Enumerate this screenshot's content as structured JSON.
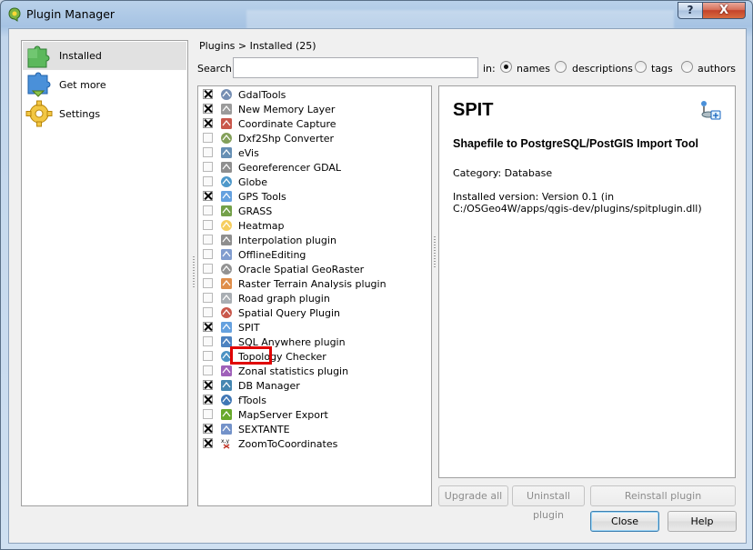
{
  "window": {
    "title": "Plugin Manager",
    "help_glyph": "?",
    "close_glyph": "X"
  },
  "nav": {
    "items": [
      {
        "label": "Installed",
        "icon": "puzzle-green-icon",
        "selected": true
      },
      {
        "label": "Get more",
        "icon": "puzzle-blue-icon",
        "selected": false
      },
      {
        "label": "Settings",
        "icon": "gear-yellow-icon",
        "selected": false
      }
    ]
  },
  "breadcrumb": "Plugins > Installed (25)",
  "search": {
    "label": "Search",
    "value": "",
    "in_label": "in:",
    "options": [
      {
        "label": "names",
        "checked": true
      },
      {
        "label": "descriptions",
        "checked": false
      },
      {
        "label": "tags",
        "checked": false
      },
      {
        "label": "authors",
        "checked": false
      }
    ]
  },
  "plugins": [
    {
      "name": "GdalTools",
      "enabled": true,
      "icon": "gdal-tools-icon"
    },
    {
      "name": "New Memory Layer",
      "enabled": true,
      "icon": "memory-layer-icon"
    },
    {
      "name": "Coordinate Capture",
      "enabled": true,
      "icon": "crosshair-icon"
    },
    {
      "name": "Dxf2Shp Converter",
      "enabled": false,
      "icon": "dxf-convert-icon"
    },
    {
      "name": "eVis",
      "enabled": false,
      "icon": "evis-icon"
    },
    {
      "name": "Georeferencer GDAL",
      "enabled": false,
      "icon": "georeferencer-icon"
    },
    {
      "name": "Globe",
      "enabled": false,
      "icon": "globe-icon"
    },
    {
      "name": "GPS Tools",
      "enabled": true,
      "icon": "gps-icon"
    },
    {
      "name": "GRASS",
      "enabled": false,
      "icon": "grass-icon"
    },
    {
      "name": "Heatmap",
      "enabled": false,
      "icon": "heatmap-icon"
    },
    {
      "name": "Interpolation plugin",
      "enabled": false,
      "icon": "interpolation-icon"
    },
    {
      "name": "OfflineEditing",
      "enabled": false,
      "icon": "offline-editing-icon"
    },
    {
      "name": "Oracle Spatial GeoRaster",
      "enabled": false,
      "icon": "oracle-georaster-icon"
    },
    {
      "name": "Raster Terrain Analysis plugin",
      "enabled": false,
      "icon": "terrain-icon"
    },
    {
      "name": "Road graph plugin",
      "enabled": false,
      "icon": "road-graph-icon"
    },
    {
      "name": "Spatial Query Plugin",
      "enabled": false,
      "icon": "spatial-query-icon"
    },
    {
      "name": "SPIT",
      "enabled": true,
      "icon": "spit-icon",
      "highlighted": true
    },
    {
      "name": "SQL Anywhere plugin",
      "enabled": false,
      "icon": "sql-anywhere-icon"
    },
    {
      "name": "Topology Checker",
      "enabled": false,
      "icon": "topology-icon"
    },
    {
      "name": "Zonal statistics plugin",
      "enabled": false,
      "icon": "zonal-stats-icon"
    },
    {
      "name": "DB Manager",
      "enabled": true,
      "icon": "db-manager-icon"
    },
    {
      "name": "fTools",
      "enabled": true,
      "icon": "ftools-icon"
    },
    {
      "name": "MapServer Export",
      "enabled": false,
      "icon": "mapserver-icon"
    },
    {
      "name": "SEXTANTE",
      "enabled": true,
      "icon": "sextante-icon"
    },
    {
      "name": "ZoomToCoordinates",
      "enabled": true,
      "icon": "zoom-coords-icon",
      "icon_text": "x,y"
    }
  ],
  "details": {
    "title": "SPIT",
    "description": "Shapefile to PostgreSQL/PostGIS Import Tool",
    "category": "Category: Database",
    "installed": "Installed version: Version 0.1 (in C:/OSGeo4W/apps/qgis-dev/plugins/spitplugin.dll)",
    "icon": "spit-plugin-icon"
  },
  "buttons": {
    "upgrade_all": "Upgrade all",
    "uninstall": "Uninstall plugin",
    "reinstall": "Reinstall plugin",
    "close": "Close",
    "help": "Help"
  }
}
